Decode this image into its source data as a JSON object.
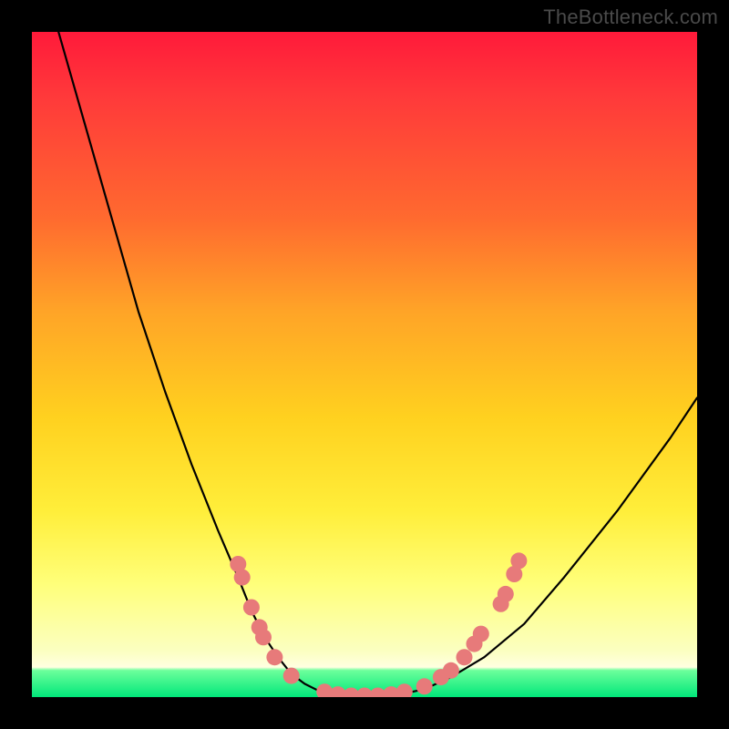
{
  "watermark": "TheBottleneck.com",
  "chart_data": {
    "type": "line",
    "title": "",
    "xlabel": "",
    "ylabel": "",
    "xlim": [
      0,
      100
    ],
    "ylim": [
      0,
      100
    ],
    "grid": false,
    "legend": false,
    "series": [
      {
        "name": "bottleneck-curve",
        "x": [
          4,
          8,
          12,
          16,
          20,
          24,
          28,
          31,
          33,
          35,
          37,
          39,
          41,
          43,
          46,
          50,
          55,
          59,
          63,
          68,
          74,
          80,
          88,
          96,
          100
        ],
        "y": [
          100,
          86,
          72,
          58,
          46,
          35,
          25,
          18,
          13,
          9,
          6,
          3.5,
          2,
          1,
          0.3,
          0,
          0.3,
          1.2,
          3,
          6,
          11,
          18,
          28,
          39,
          45
        ]
      }
    ],
    "markers": {
      "name": "highlight-dots",
      "color": "#e77a7a",
      "points": [
        {
          "x": 31.0,
          "y": 20.0
        },
        {
          "x": 31.6,
          "y": 18.0
        },
        {
          "x": 33.0,
          "y": 13.5
        },
        {
          "x": 34.2,
          "y": 10.5
        },
        {
          "x": 34.8,
          "y": 9.0
        },
        {
          "x": 36.5,
          "y": 6.0
        },
        {
          "x": 39.0,
          "y": 3.2
        },
        {
          "x": 44.0,
          "y": 0.8
        },
        {
          "x": 46.0,
          "y": 0.4
        },
        {
          "x": 48.0,
          "y": 0.2
        },
        {
          "x": 50.0,
          "y": 0.2
        },
        {
          "x": 52.0,
          "y": 0.2
        },
        {
          "x": 54.0,
          "y": 0.4
        },
        {
          "x": 56.0,
          "y": 0.8
        },
        {
          "x": 59.0,
          "y": 1.6
        },
        {
          "x": 61.5,
          "y": 3.0
        },
        {
          "x": 63.0,
          "y": 4.0
        },
        {
          "x": 65.0,
          "y": 6.0
        },
        {
          "x": 66.5,
          "y": 8.0
        },
        {
          "x": 67.5,
          "y": 9.5
        },
        {
          "x": 70.5,
          "y": 14.0
        },
        {
          "x": 71.2,
          "y": 15.5
        },
        {
          "x": 72.5,
          "y": 18.5
        },
        {
          "x": 73.2,
          "y": 20.5
        }
      ]
    },
    "background_gradient": {
      "top": "#ff1a3a",
      "mid_upper": "#ffa427",
      "mid": "#ffee3a",
      "lower": "#fbffc0",
      "bottom": "#00e77a"
    }
  }
}
